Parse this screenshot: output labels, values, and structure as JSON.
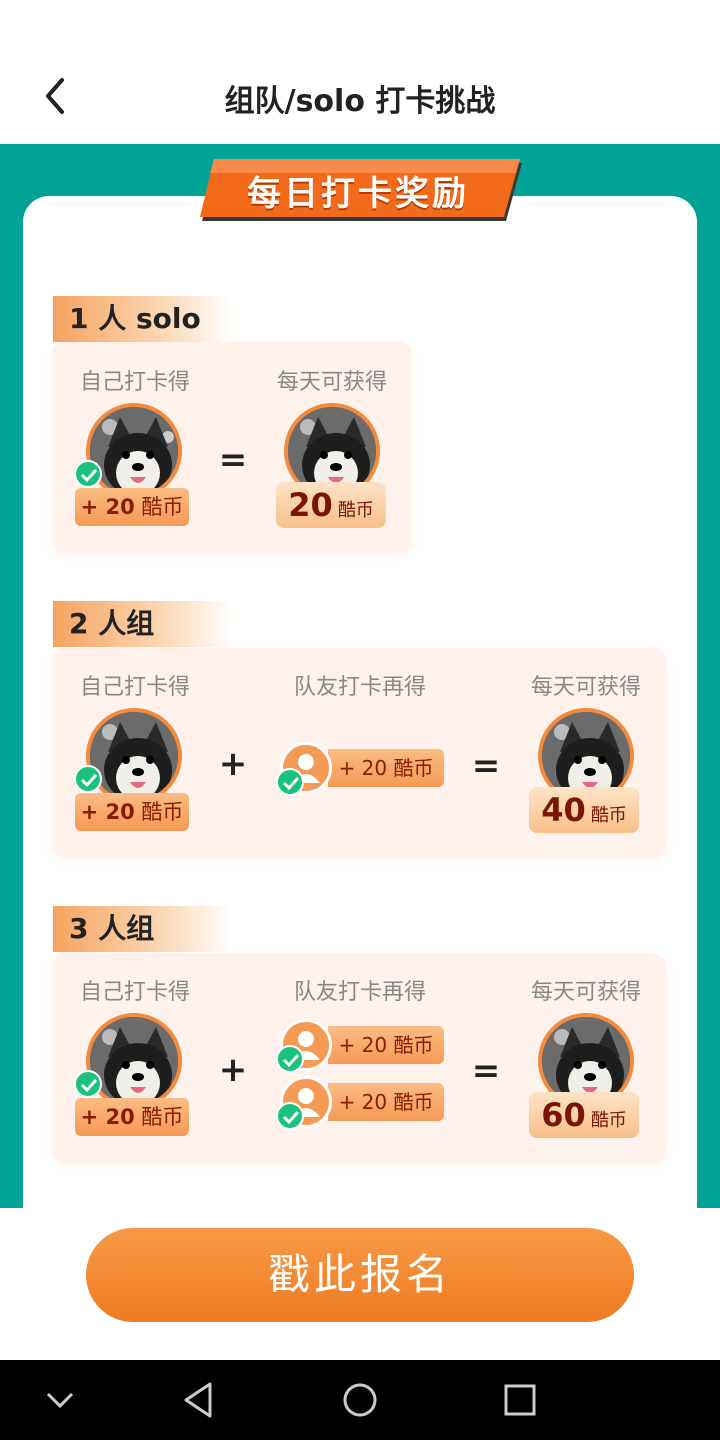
{
  "header": {
    "title": "组队/solo 打卡挑战"
  },
  "banner": {
    "text": "每日打卡奖励"
  },
  "sections": [
    {
      "label": "1 人 solo",
      "self_caption": "自己打卡得",
      "self_reward": "+ 20",
      "unit": "酷币",
      "total_caption": "每天可获得",
      "total": "20",
      "op_equals": "="
    },
    {
      "label": "2 人组",
      "self_caption": "自己打卡得",
      "self_reward": "+ 20",
      "unit": "酷币",
      "mate_caption": "队友打卡再得",
      "mate_rewards": [
        "+ 20 酷币"
      ],
      "total_caption": "每天可获得",
      "total": "40",
      "op_plus": "+",
      "op_equals": "="
    },
    {
      "label": "3 人组",
      "self_caption": "自己打卡得",
      "self_reward": "+ 20",
      "unit": "酷币",
      "mate_caption": "队友打卡再得",
      "mate_rewards": [
        "+ 20 酷币",
        "+ 20 酷币"
      ],
      "total_caption": "每天可获得",
      "total": "60",
      "op_plus": "+",
      "op_equals": "="
    }
  ],
  "signup_button": "戳此报名",
  "colors": {
    "teal": "#00a396",
    "orange": "#ee7b22",
    "check": "#19c27f"
  }
}
